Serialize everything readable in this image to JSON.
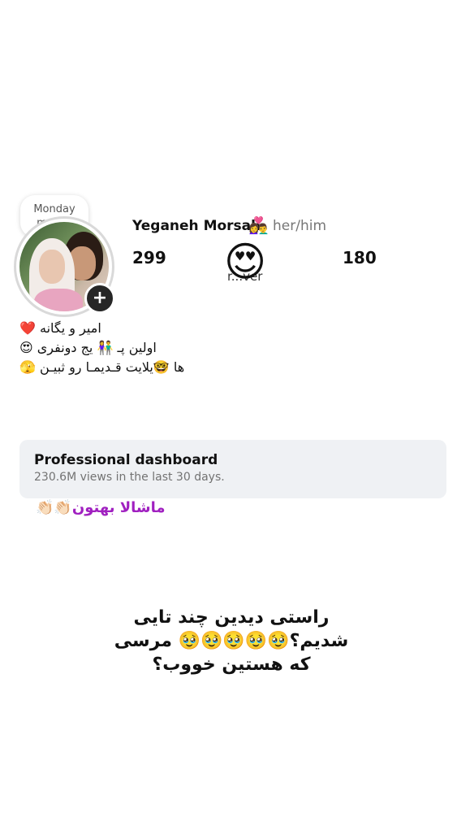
{
  "note": {
    "text": "Monday mood?"
  },
  "profile": {
    "name": "Yeganeh Morsali",
    "name_emoji": "👩‍❤️‍👨",
    "pronouns": "her/him",
    "stat_left": "299",
    "stat_right": "180",
    "stat_label": "r...ver",
    "overlay_emoji": "😍"
  },
  "bio": {
    "line1": "امیر و یگانه ❤️",
    "line2": "اولین پـ 👫 یج دونفری 😍",
    "line3": "ها 🤓یلایت قـدیمـا رو ثبیـن 🫣"
  },
  "dashboard": {
    "title": "Professional dashboard",
    "subtitle": "230.6M views in the last 30 days."
  },
  "caption": "ماشالا بهتون👏🏻👏🏻",
  "story_text": {
    "line1": "راستی دیدین چند تایی",
    "line2": "شدیم؟🥹🥹🥹🥹🥹 مرسی",
    "line3": "که هستین خووب؟"
  },
  "icons": {
    "add": "plus-icon"
  }
}
